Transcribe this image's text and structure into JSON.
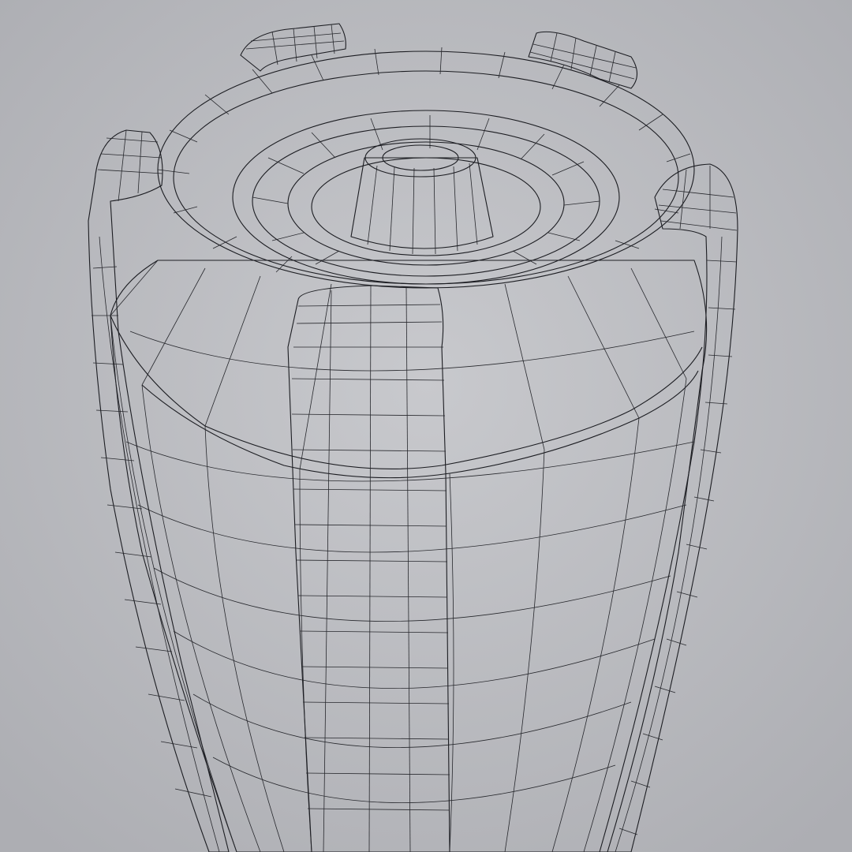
{
  "scene": {
    "subject": "amphora-wireframe-render",
    "colors": {
      "background": "#b9babf",
      "background_light": "#c7c8cc",
      "surface": "#dcdde2",
      "surface_dark": "#a9aab0",
      "wire": "#1c1d22"
    }
  }
}
